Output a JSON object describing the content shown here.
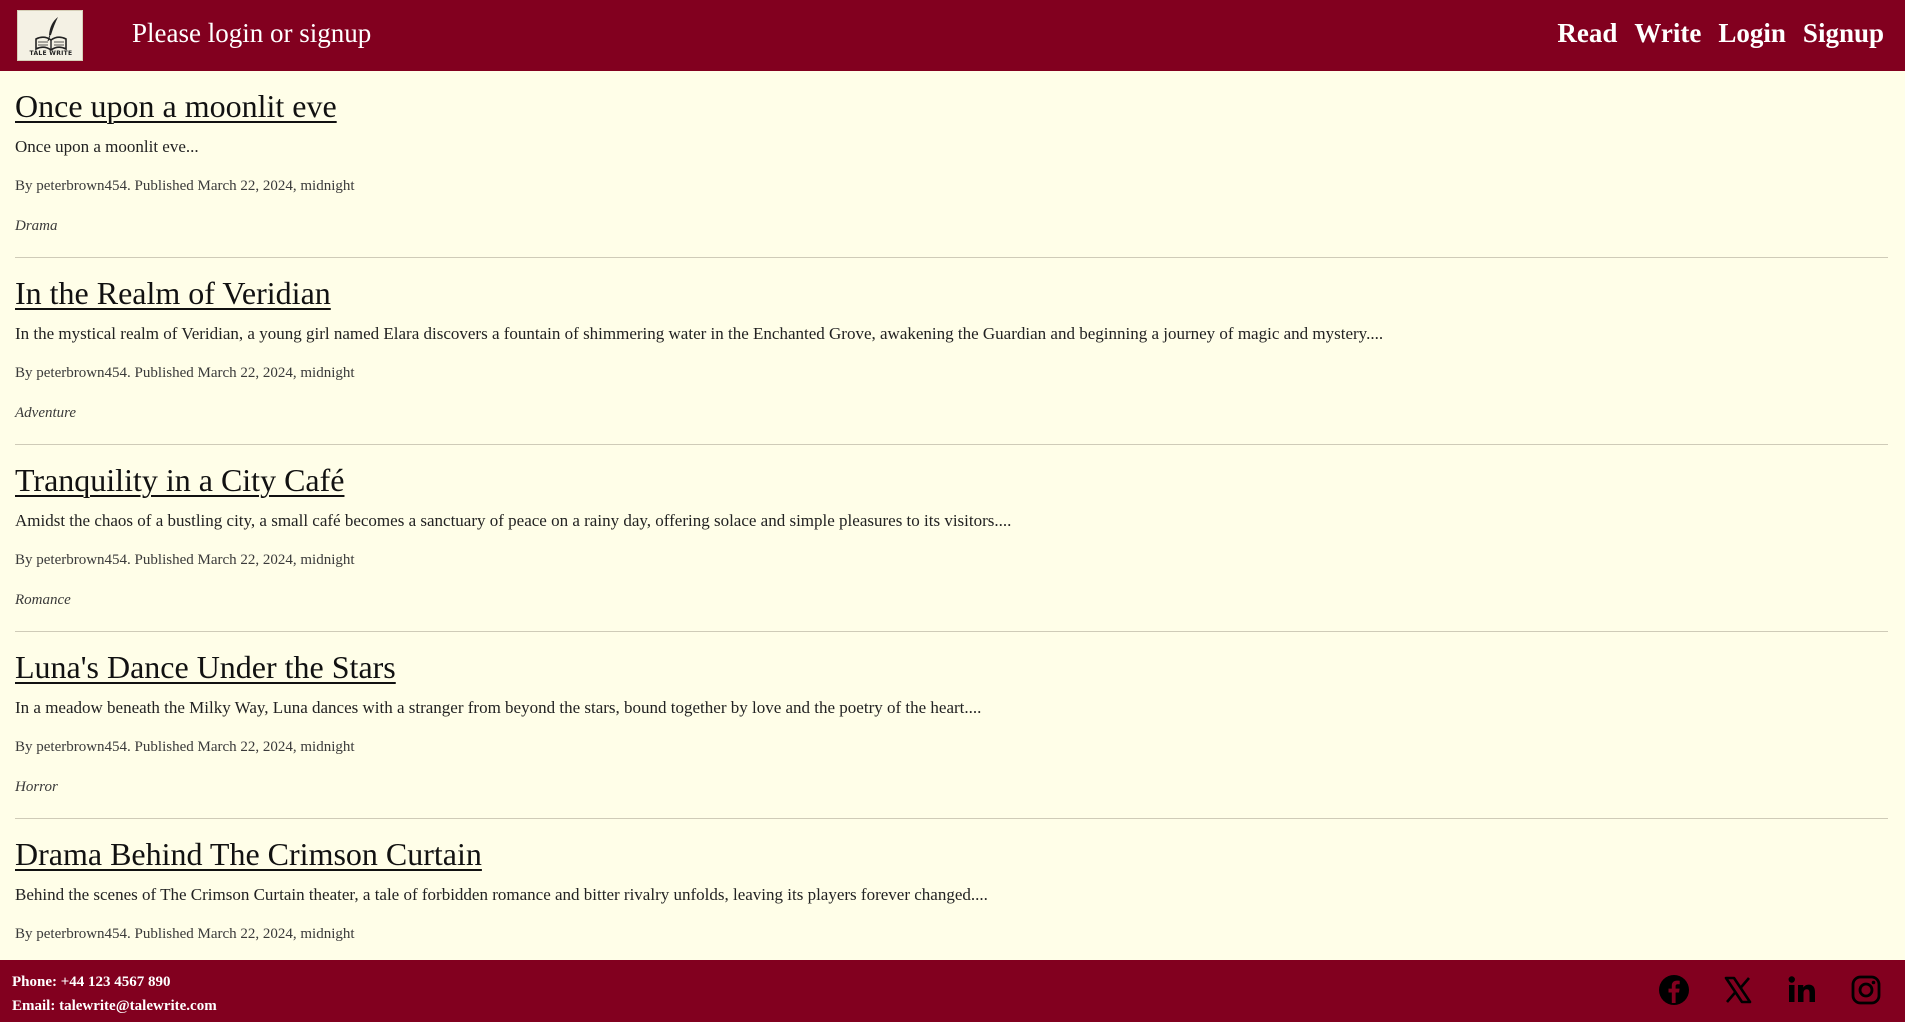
{
  "header": {
    "logo_text": "TALE WRITE",
    "title": "Please login or signup",
    "nav": [
      "Read",
      "Write",
      "Login",
      "Signup"
    ]
  },
  "stories": [
    {
      "title": "Once upon a moonlit eve",
      "excerpt": "Once upon a moonlit eve...",
      "meta": "By peterbrown454. Published March 22, 2024, midnight",
      "genre": "Drama"
    },
    {
      "title": "In the Realm of Veridian",
      "excerpt": "In the mystical realm of Veridian, a young girl named Elara discovers a fountain of shimmering water in the Enchanted Grove, awakening the Guardian and beginning a journey of magic and mystery....",
      "meta": "By peterbrown454. Published March 22, 2024, midnight",
      "genre": "Adventure"
    },
    {
      "title": "Tranquility in a City Café",
      "excerpt": "Amidst the chaos of a bustling city, a small café becomes a sanctuary of peace on a rainy day, offering solace and simple pleasures to its visitors....",
      "meta": "By peterbrown454. Published March 22, 2024, midnight",
      "genre": "Romance"
    },
    {
      "title": "Luna's Dance Under the Stars",
      "excerpt": "In a meadow beneath the Milky Way, Luna dances with a stranger from beyond the stars, bound together by love and the poetry of the heart....",
      "meta": "By peterbrown454. Published March 22, 2024, midnight",
      "genre": "Horror"
    },
    {
      "title": "Drama Behind The Crimson Curtain",
      "excerpt": "Behind the scenes of The Crimson Curtain theater, a tale of forbidden romance and bitter rivalry unfolds, leaving its players forever changed....",
      "meta": "By peterbrown454. Published March 22, 2024, midnight",
      "genre": ""
    }
  ],
  "footer": {
    "phone": "Phone: +44 123 4567 890",
    "email": "Email: talewrite@talewrite.com",
    "socials": [
      "facebook-icon",
      "x-icon",
      "linkedin-icon",
      "instagram-icon"
    ]
  },
  "colors": {
    "brand": "#82001f",
    "background": "#fffee8"
  }
}
